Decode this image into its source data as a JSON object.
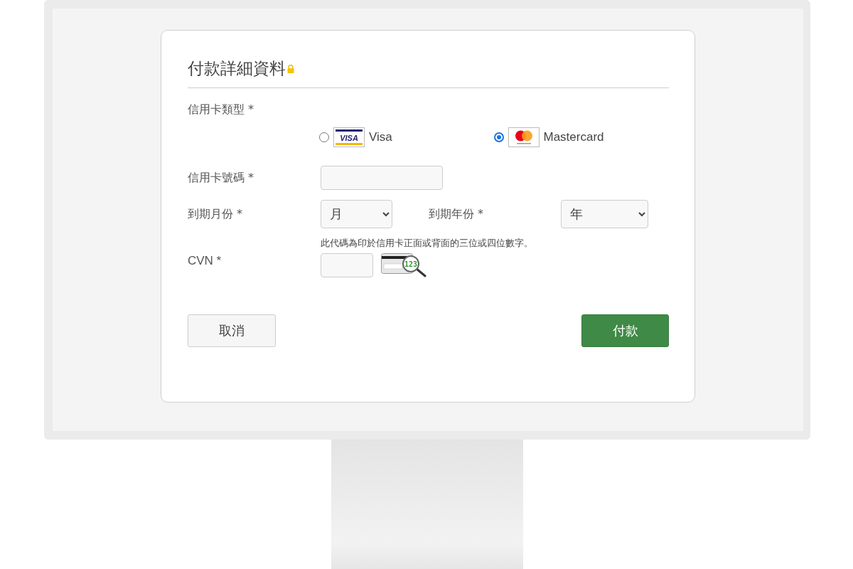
{
  "form": {
    "title": "付款詳細資料",
    "secure": true,
    "card_type": {
      "label": "信用卡類型 *",
      "options": [
        {
          "kind": "visa",
          "logo_text": "VISA",
          "label": "Visa",
          "selected": false
        },
        {
          "kind": "mastercard",
          "label": "Mastercard",
          "selected": true
        }
      ]
    },
    "card_number": {
      "label": "信用卡號碼 *"
    },
    "expiry_month": {
      "label": "到期月份 *",
      "value": "月"
    },
    "expiry_year": {
      "label": "到期年份 *",
      "value": "年"
    },
    "cvn": {
      "label": "CVN *",
      "hint": "此代碼為印於信用卡正面或背面的三位或四位數字。",
      "icon_text": "123"
    },
    "buttons": [
      {
        "kind": "secondary",
        "label": "取消"
      },
      {
        "kind": "primary",
        "label": "付款"
      }
    ]
  }
}
